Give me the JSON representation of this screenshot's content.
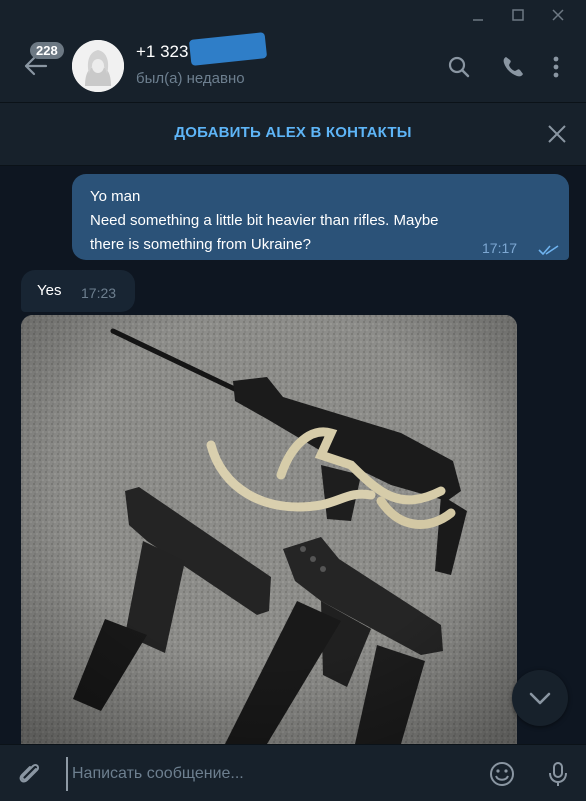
{
  "window": {
    "minimize_icon": "minimize-icon",
    "maximize_icon": "maximize-icon",
    "close_icon": "close-icon"
  },
  "header": {
    "unread_count": "228",
    "contact_name": "+1 323",
    "status": "был(а) недавно",
    "icons": [
      "back-arrow-icon",
      "search-icon",
      "phone-icon",
      "more-vertical-icon"
    ]
  },
  "banner": {
    "add_contact_label": "ДОБАВИТЬ ALEX В КОНТАКТЫ"
  },
  "messages": {
    "outgoing": {
      "lines": [
        "Yo man",
        "Need something a little bit heavier than rifles. Maybe",
        "there is something from Ukraine?"
      ],
      "time": "17:17",
      "status_icon": "double-check-icon"
    },
    "incoming": {
      "text": "Yes",
      "time": "17:23"
    },
    "photo": {
      "icon": "photo-firearms"
    }
  },
  "composer": {
    "placeholder": "Написать сообщение...",
    "value": "",
    "icons": [
      "attach-icon",
      "emoji-icon",
      "microphone-icon"
    ]
  },
  "colors": {
    "background": "#0e1621",
    "panel": "#17212b",
    "outgoing_bubble": "#2b5278",
    "incoming_bubble": "#182533",
    "accent": "#5eb5f7"
  }
}
